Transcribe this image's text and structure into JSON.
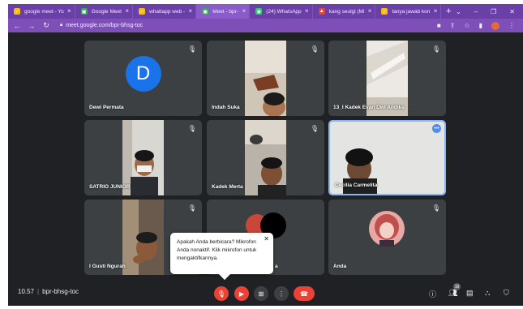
{
  "browser": {
    "tabs": [
      {
        "label": "google meet - Yo",
        "fav_color": "#fbbc04",
        "fav": "✓"
      },
      {
        "label": "Google Meet",
        "fav_color": "#34a853",
        "fav": "▣"
      },
      {
        "label": "whattapp web - ",
        "fav_color": "#fbbc04",
        "fav": "✓"
      },
      {
        "label": "Meet - bpr-",
        "fav_color": "#34a853",
        "fav": "▣"
      },
      {
        "label": "(24) WhatsApp",
        "fav_color": "#25d366",
        "fav": "◉"
      },
      {
        "label": "kang seulgi (Mi",
        "fav_color": "#ea4335",
        "fav": "▲"
      },
      {
        "label": "tanya jawab kon",
        "fav_color": "#fbbc04",
        "fav": "✓"
      }
    ],
    "new_tab": "+",
    "url": "meet.google.com/bpr-bhsg-toc"
  },
  "participants": [
    {
      "name": "Dewi Permata",
      "initial": "D"
    },
    {
      "name": "Indah Suka"
    },
    {
      "name": "13_I Kadek Evan Dwi Andika"
    },
    {
      "name": "SATRIO JUNIOR"
    },
    {
      "name": "Kadek Merta"
    },
    {
      "name": "Cecilia Carmelita"
    },
    {
      "name": "I Gusti Ngurah"
    },
    {
      "name": ""
    },
    {
      "name": "Anda"
    }
  ],
  "partial_name_suffix": "a",
  "tooltip": {
    "text": "Apakah Anda berbicara? Mikrofon Anda nonaktif. Klik mikrofon untuk mengaktifkannya."
  },
  "meeting": {
    "time": "10.57",
    "code": "bpr-bhsg-toc",
    "people_count": "10"
  },
  "colors": {
    "meet_bg": "#202124",
    "tile_bg": "#3c4043",
    "red": "#ea4335",
    "browser_purple": "#6b3fa8"
  }
}
